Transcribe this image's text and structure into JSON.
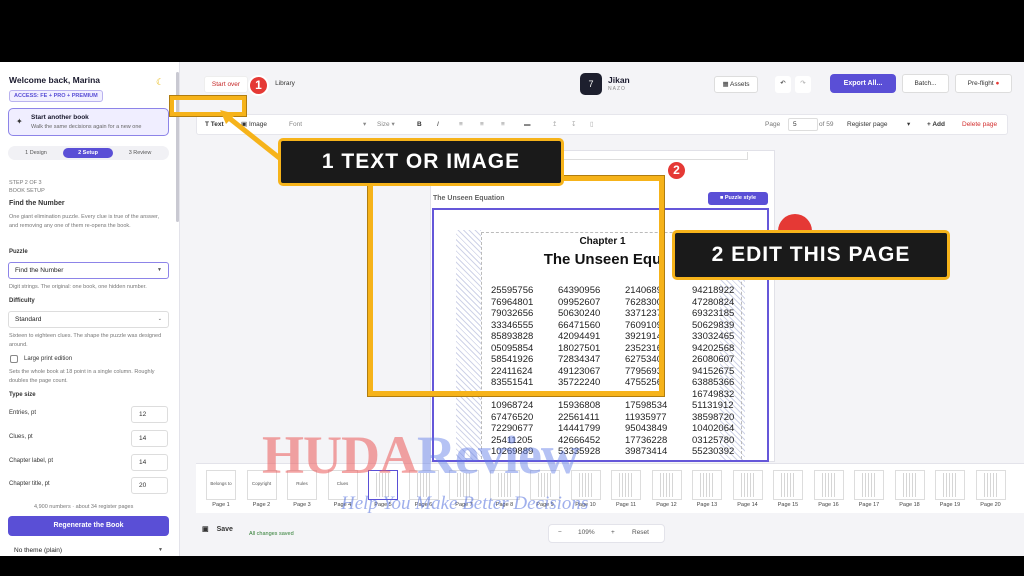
{
  "sidebar": {
    "welcome": "Welcome back, Marina",
    "access_badge": "ACCESS: FE + PRO + PREMIUM",
    "another": {
      "title": "Start another book",
      "subtitle": "Walk the same decisions again for a new one"
    },
    "steps": [
      "1 Design",
      "2 Setup",
      "3 Review"
    ],
    "step_label": "STEP 2 OF 3",
    "section_label": "BOOK SETUP",
    "setup_title": "Find the Number",
    "setup_desc": "One giant elimination puzzle. Every clue is true of the answer, and removing any one of them re-opens the book.",
    "puzzle_label": "Puzzle",
    "puzzle_value": "Find the Number",
    "puzzle_help": "Digit strings. The original: one book, one hidden number.",
    "difficulty_label": "Difficulty",
    "difficulty_value": "Standard",
    "difficulty_help": "Sixteen to eighteen clues. The shape the puzzle was designed around.",
    "large_print_label": "Large print edition",
    "large_print_help": "Sets the whole book at 18 point in a single column. Roughly doubles the page count.",
    "type_size_label": "Type size",
    "sizes": [
      {
        "label": "Entries, pt",
        "value": "12"
      },
      {
        "label": "Clues, pt",
        "value": "14"
      },
      {
        "label": "Chapter label, pt",
        "value": "14"
      },
      {
        "label": "Chapter title, pt",
        "value": "20"
      }
    ],
    "summary": "4,900 numbers · about 34 register pages",
    "regenerate": "Regenerate the Book",
    "theme_value": "No theme (plain)"
  },
  "topbar": {
    "start_over": "Start over",
    "library": "Library",
    "app_name": "Jikan",
    "app_sub": "NAZO",
    "assets": "Assets",
    "undo": "↶",
    "redo": "↷",
    "export": "Export All...",
    "batch": "Batch...",
    "preflight": "Pre-flight"
  },
  "toolbar": {
    "text": "Text",
    "image": "Image",
    "font": "Font",
    "size": "Size",
    "bold": "B",
    "italic": "I",
    "page_label": "Page",
    "page_value": "5",
    "page_total": "of 59",
    "page_type": "Register page",
    "add": "+ Add",
    "delete": "Delete page"
  },
  "canvas": {
    "doc_title": "The Unseen Equation",
    "puzzle_style": "Puzzle style",
    "chapter": "Chapter 1",
    "title": "The Unseen Equ",
    "rows": [
      [
        "25595756",
        "64390956",
        "2140689",
        "94218922"
      ],
      [
        "76964801",
        "09952607",
        "7628300",
        "47280824"
      ],
      [
        "79032656",
        "50630240",
        "3371237",
        "69323185"
      ],
      [
        "33346555",
        "66471560",
        "7609109",
        "50629839"
      ],
      [
        "85893828",
        "42094491",
        "3921914",
        "33032465"
      ],
      [
        "05095854",
        "18027501",
        "2352316",
        "94202568"
      ],
      [
        "58541926",
        "72834347",
        "6275340",
        "26080607"
      ],
      [
        "22411624",
        "49123067",
        "7795693",
        "94152675"
      ],
      [
        "83551541",
        "35722240",
        "4755256",
        "63885366"
      ],
      [
        "",
        "",
        "",
        "16749832"
      ],
      [
        "10968724",
        "15936808",
        "17598534",
        "51131912"
      ],
      [
        "67476520",
        "22561411",
        "11935977",
        "38598720"
      ],
      [
        "72290677",
        "14441799",
        "95043849",
        "10402064"
      ],
      [
        "25411205",
        "42666452",
        "17736228",
        "03125780"
      ],
      [
        "10269889",
        "53335928",
        "39873414",
        "55230392"
      ]
    ]
  },
  "thumbnails": [
    {
      "label": "Page 1",
      "content": "Belongs to"
    },
    {
      "label": "Page 2",
      "content": "Copyright"
    },
    {
      "label": "Page 3",
      "content": "Rules"
    },
    {
      "label": "Page 4",
      "content": "Clues"
    },
    {
      "label": "Page 5",
      "content": ""
    },
    {
      "label": "Page 6",
      "content": ""
    },
    {
      "label": "Page 7",
      "content": ""
    },
    {
      "label": "Page 8",
      "content": ""
    },
    {
      "label": "Page 9",
      "content": ""
    },
    {
      "label": "Page 10",
      "content": ""
    },
    {
      "label": "Page 11",
      "content": ""
    },
    {
      "label": "Page 12",
      "content": ""
    },
    {
      "label": "Page 13",
      "content": ""
    },
    {
      "label": "Page 14",
      "content": ""
    },
    {
      "label": "Page 15",
      "content": ""
    },
    {
      "label": "Page 16",
      "content": ""
    },
    {
      "label": "Page 17",
      "content": ""
    },
    {
      "label": "Page 18",
      "content": ""
    },
    {
      "label": "Page 19",
      "content": ""
    },
    {
      "label": "Page 20",
      "content": ""
    }
  ],
  "footer": {
    "save": "Save",
    "saved_status": "All changes saved",
    "zoom_minus": "−",
    "zoom": "109%",
    "zoom_plus": "+",
    "reset": "Reset"
  },
  "annotations": {
    "marker1": "1",
    "marker2": "2",
    "callout1": "1  TEXT OR IMAGE",
    "callout2": "2  EDIT THIS PAGE"
  },
  "watermark": {
    "brand_a": "HUDA",
    "brand_b": "Review",
    "tagline": "Help You Make Better Decisions"
  },
  "colors": {
    "accent": "#5a4fd6",
    "highlight": "#f6b31a",
    "marker": "#e53935"
  }
}
